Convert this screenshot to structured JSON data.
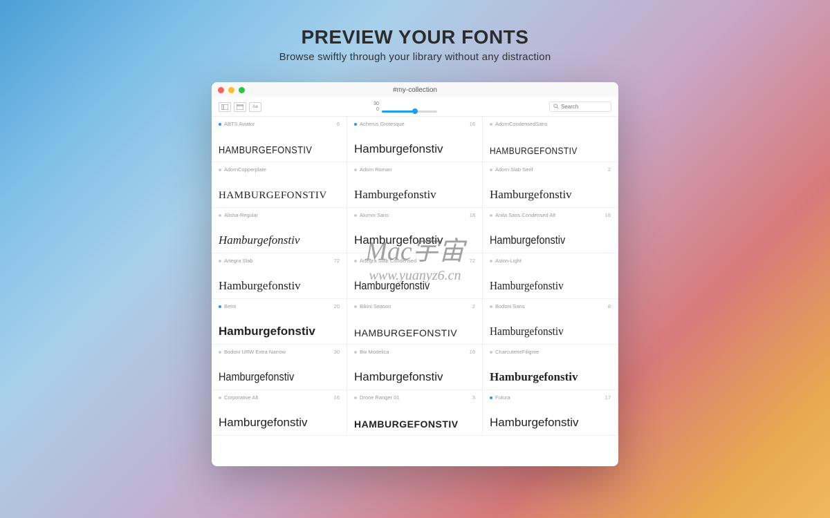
{
  "hero": {
    "title": "PREVIEW YOUR FONTS",
    "subtitle": "Browse swiftly through your library without any distraction"
  },
  "window": {
    "title": "#my-collection"
  },
  "toolbar": {
    "slider_value": 30,
    "slider_min": 0,
    "search_placeholder": "Search"
  },
  "fonts": [
    {
      "name": "ABTS Aviator",
      "count": "6",
      "active": true,
      "sample": "HAMBURGEFONSTIV",
      "style": "f-smallcaps f-narrow"
    },
    {
      "name": "Acherus Grotesque",
      "count": "16",
      "active": true,
      "sample": "Hamburgefonstiv",
      "style": "f-sans"
    },
    {
      "name": "AdornCondensedSans",
      "count": "",
      "active": false,
      "sample": "HAMBURGEFONSTIV",
      "style": "f-caps f-narrow f-light"
    },
    {
      "name": "AdornCopperplate",
      "count": "",
      "active": false,
      "sample": "HAMBURGEFONSTIV",
      "style": "f-smallcaps f-serif"
    },
    {
      "name": "Adorn Roman",
      "count": "",
      "active": false,
      "sample": "Hamburgefonstiv",
      "style": "f-serif"
    },
    {
      "name": "Adorn Slab Serif",
      "count": "2",
      "active": false,
      "sample": "Hamburgefonstiv",
      "style": "f-serif"
    },
    {
      "name": "Alisha-Regular",
      "count": "",
      "active": false,
      "sample": "Hamburgefonstiv",
      "style": "f-cursive"
    },
    {
      "name": "Alumni Sans",
      "count": "18",
      "active": false,
      "sample": "Hamburgefonstiv",
      "style": "f-sans f-light"
    },
    {
      "name": "Anita Sans Condensed Alt",
      "count": "18",
      "active": false,
      "sample": "Hamburgefonstiv",
      "style": "f-narrow"
    },
    {
      "name": "Artegra Slab",
      "count": "72",
      "active": false,
      "sample": "Hamburgefonstiv",
      "style": "f-serif"
    },
    {
      "name": "Artegra Slab Condensed",
      "count": "72",
      "active": false,
      "sample": "Hamburgefonstiv",
      "style": "f-serif f-narrow"
    },
    {
      "name": "Aston-Light",
      "count": "",
      "active": false,
      "sample": "Hamburgefonstiv",
      "style": "f-thin-serif"
    },
    {
      "name": "Betm",
      "count": "20",
      "active": true,
      "sample": "Hamburgefonstiv",
      "style": "f-sans f-bold"
    },
    {
      "name": "Bikini Season",
      "count": "2",
      "active": false,
      "sample": "HAMBURGEFONSTIV",
      "style": "f-caps f-light"
    },
    {
      "name": "Bodoni Sans",
      "count": "8",
      "active": false,
      "sample": "Hamburgefonstiv",
      "style": "f-thin-serif"
    },
    {
      "name": "Bodoni URW Extra Narrow",
      "count": "30",
      "active": false,
      "sample": "Hamburgefonstiv",
      "style": "f-serif f-narrow"
    },
    {
      "name": "Bw Modelica",
      "count": "16",
      "active": false,
      "sample": "Hamburgefonstiv",
      "style": "f-sans"
    },
    {
      "name": "CharcuterieFiligree",
      "count": "",
      "active": false,
      "sample": "Hamburgefonstiv",
      "style": "f-serif f-bold"
    },
    {
      "name": "Corporative Alt",
      "count": "16",
      "active": false,
      "sample": "Hamburgefonstiv",
      "style": "f-sans"
    },
    {
      "name": "Drone Ranger 01",
      "count": "3",
      "active": false,
      "sample": "HAMBURGEFONSTIV",
      "style": "f-caps f-bold"
    },
    {
      "name": "Futura",
      "count": "17",
      "active": true,
      "sample": "Hamburgefonstiv",
      "style": "f-sans"
    }
  ],
  "watermark": {
    "line1": "Mac宇宙",
    "line2": "www.yuanyz6.cn"
  }
}
